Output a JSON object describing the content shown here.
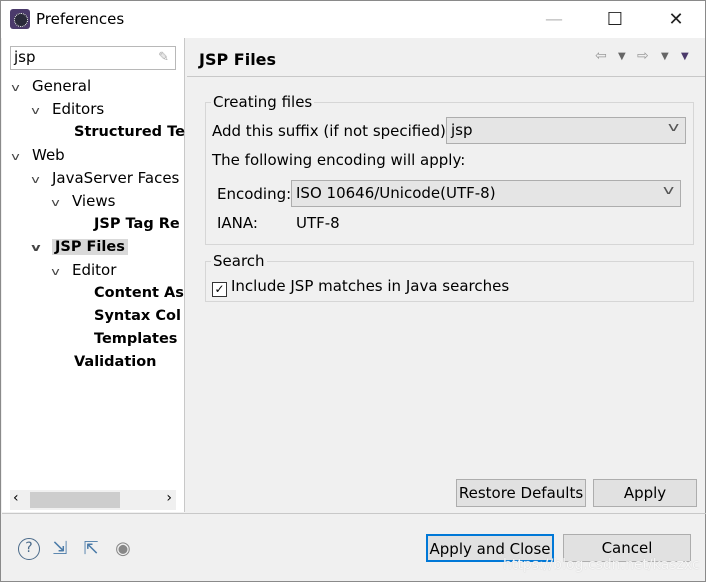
{
  "window": {
    "title": "Preferences",
    "minimize": "—",
    "maximize": "☐",
    "close": "✕"
  },
  "sidebar": {
    "filter_value": "jsp",
    "tree": [
      {
        "label": "General",
        "level": 0,
        "expanded": true,
        "bold": false
      },
      {
        "label": "Editors",
        "level": 1,
        "expanded": true,
        "bold": false
      },
      {
        "label": "Structured Te",
        "level": 2,
        "bold": true
      },
      {
        "label": "Web",
        "level": 0,
        "expanded": true,
        "bold": false
      },
      {
        "label": "JavaServer Faces",
        "level": 1,
        "expanded": true,
        "bold": false
      },
      {
        "label": "Views",
        "level": 2,
        "expanded": true,
        "bold": false
      },
      {
        "label": "JSP Tag Re",
        "level": 3,
        "bold": true
      },
      {
        "label": "JSP Files",
        "level": 1,
        "expanded": true,
        "bold": true,
        "selected": true
      },
      {
        "label": "Editor",
        "level": 2,
        "expanded": true,
        "bold": false
      },
      {
        "label": "Content As",
        "level": 3,
        "bold": true
      },
      {
        "label": "Syntax Col",
        "level": 3,
        "bold": true
      },
      {
        "label": "Templates",
        "level": 3,
        "bold": true
      },
      {
        "label": "Validation",
        "level": 2,
        "bold": true
      }
    ]
  },
  "page": {
    "title": "JSP Files",
    "creating": {
      "legend": "Creating files",
      "suffix_label": "Add this suffix (if not specified):",
      "suffix_value": "jsp",
      "encoding_note": "The following encoding will apply:",
      "encoding_label": "Encoding:",
      "encoding_value": "ISO 10646/Unicode(UTF-8)",
      "iana_label": "IANA:",
      "iana_value": "UTF-8"
    },
    "search": {
      "legend": "Search",
      "include_label": "Include JSP matches in Java searches",
      "include_checked": true
    },
    "restore_defaults": "Restore Defaults",
    "apply": "Apply"
  },
  "footer": {
    "apply_close": "Apply and Close",
    "cancel": "Cancel"
  },
  "watermark": "https://blog.csdn.net/kaszxc",
  "colors": {
    "focus": "#0078d7",
    "selection": "#d9d9d9"
  }
}
